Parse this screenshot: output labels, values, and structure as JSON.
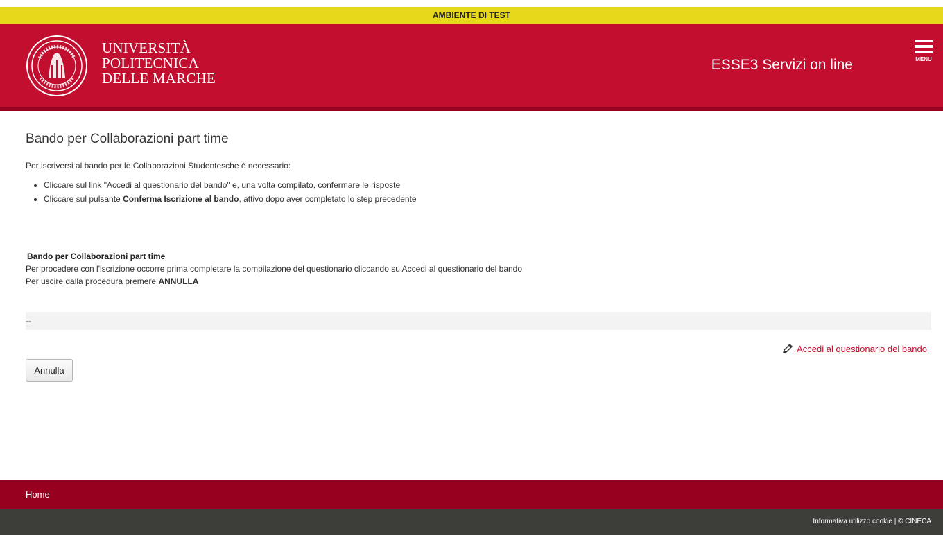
{
  "env_banner": "AMBIENTE DI TEST",
  "header": {
    "university_line1": "UNIVERSITÀ",
    "university_line2": "POLITECNICA",
    "university_line3": "DELLE MARCHE",
    "service_title": "ESSE3 Servizi on line",
    "menu_label": "MENU",
    "menu_icon": "hamburger-icon",
    "colors": {
      "header_bg": "#c20e2f",
      "header_border": "#98001f",
      "test_bar": "#e6d81a"
    }
  },
  "page": {
    "title": "Bando per Collaborazioni part time",
    "intro": "Per iscriversi al bando per le Collaborazioni Studentesche è necessario:",
    "steps": [
      {
        "text": "Cliccare sul link \"Accedi al questionario del bando\" e, una volta compilato, confermare le risposte"
      },
      {
        "before": "Cliccare sul pulsante ",
        "bold": "Conferma Iscrizione al bando",
        "after": ", attivo dopo aver completato lo step precedente"
      }
    ]
  },
  "box": {
    "title": "Bando per Collaborazioni part time",
    "line1": "Per procedere con l'iscrizione occorre prima completare la compilazione del questionario cliccando su Accedi al questionario del bando",
    "line2_prefix": "Per uscire dalla procedura premere ",
    "line2_bold": "ANNULLA"
  },
  "placeholder_row": "--",
  "questionnaire_link": {
    "label": "Accedi al questionario del bando",
    "icon": "pencil-icon"
  },
  "cancel_button": "Annulla",
  "footer": {
    "home": "Home",
    "bottom": "Informativa utilizzo cookie | © CINECA"
  }
}
